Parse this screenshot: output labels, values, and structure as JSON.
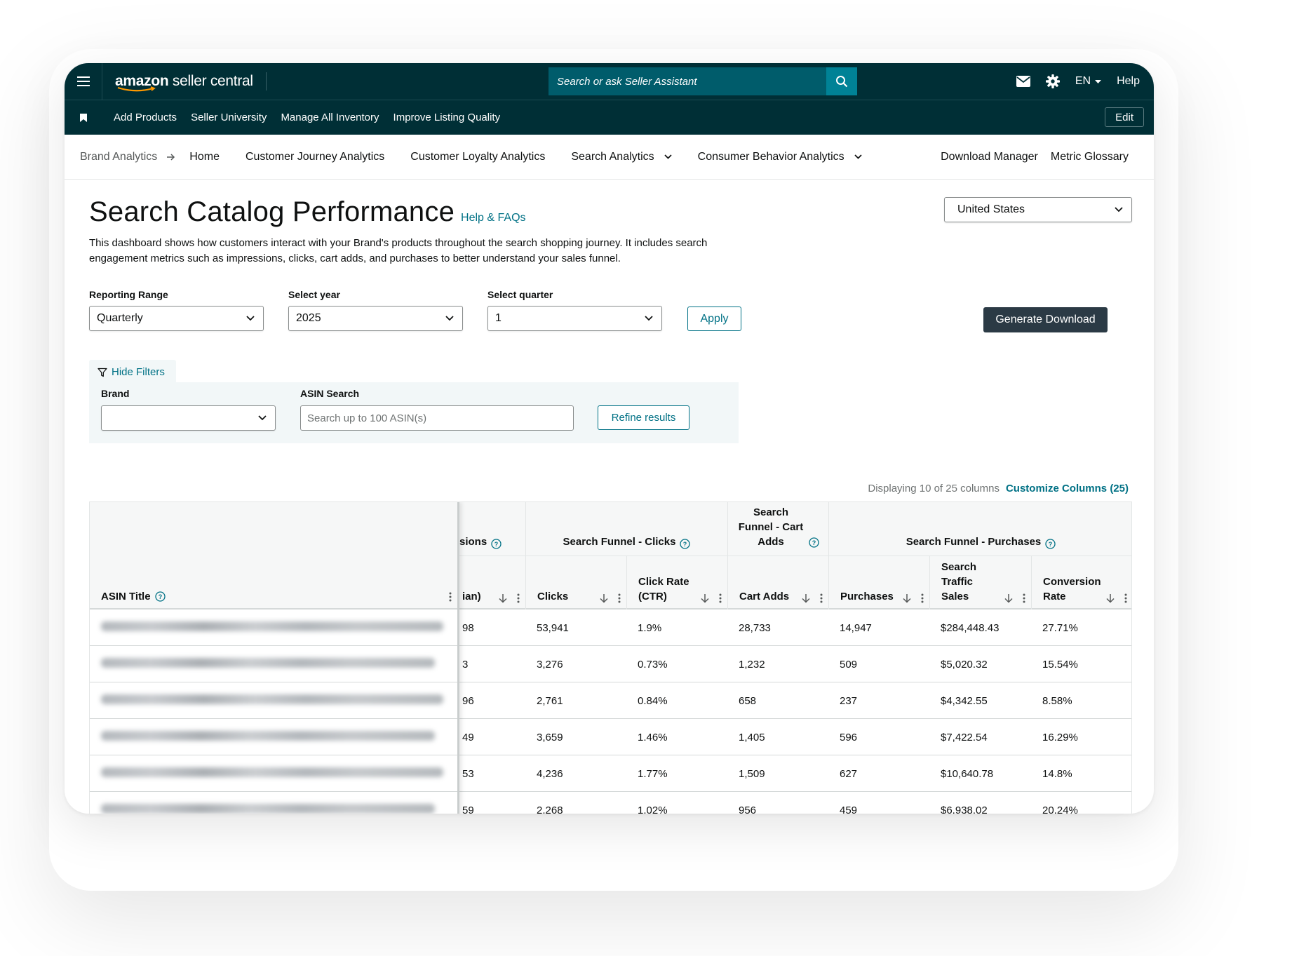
{
  "topbar": {
    "logo_bold": "amazon",
    "logo_rest": " seller central",
    "search_placeholder": "Search or ask Seller Assistant",
    "lang": "EN",
    "help": "Help"
  },
  "subbar": {
    "links": [
      "Add Products",
      "Seller University",
      "Manage All Inventory",
      "Improve Listing Quality"
    ],
    "edit": "Edit"
  },
  "nav": {
    "breadcrumb": "Brand Analytics",
    "items": [
      "Home",
      "Customer Journey Analytics",
      "Customer Loyalty Analytics",
      "Search Analytics",
      "Consumer Behavior Analytics"
    ],
    "download_manager": "Download Manager",
    "metric_glossary": "Metric Glossary"
  },
  "page": {
    "title": "Search Catalog Performance",
    "help_faqs": "Help & FAQs",
    "description": "This dashboard shows how customers interact with your Brand's products throughout the search shopping journey. It includes search engagement metrics such as impressions, clicks, cart adds, and purchases to better understand your sales funnel.",
    "country": "United States"
  },
  "controls": {
    "reporting_range_label": "Reporting Range",
    "reporting_range_value": "Quarterly",
    "year_label": "Select year",
    "year_value": "2025",
    "quarter_label": "Select quarter",
    "quarter_value": "1",
    "apply": "Apply",
    "generate_download": "Generate Download"
  },
  "filters": {
    "hide_filters": "Hide Filters",
    "brand_label": "Brand",
    "brand_value": "",
    "asin_label": "ASIN Search",
    "asin_placeholder": "Search up to 100 ASIN(s)",
    "refine": "Refine results"
  },
  "table_meta": {
    "displaying": "Displaying 10 of 25 columns",
    "customize": "Customize Columns (25)"
  },
  "table": {
    "groups": {
      "impressions_partial": "sions",
      "clicks": "Search Funnel - Clicks",
      "cart_adds": "Search Funnel - Cart Adds",
      "purchases": "Search Funnel - Purchases"
    },
    "columns": {
      "asin_title": "ASIN Title",
      "median_partial": "ian)",
      "clicks": "Clicks",
      "click_rate": "Click Rate (CTR)",
      "cart_adds": "Cart Adds",
      "purchases": "Purchases",
      "search_traffic_sales": "Search Traffic Sales",
      "conversion_rate": "Conversion Rate"
    },
    "rows": [
      {
        "partial": "98",
        "clicks": "53,941",
        "ctr": "1.9%",
        "cart_adds": "28,733",
        "purchases": "14,947",
        "sales": "$284,448.43",
        "conv": "27.71%"
      },
      {
        "partial": "3",
        "clicks": "3,276",
        "ctr": "0.73%",
        "cart_adds": "1,232",
        "purchases": "509",
        "sales": "$5,020.32",
        "conv": "15.54%"
      },
      {
        "partial": "96",
        "clicks": "2,761",
        "ctr": "0.84%",
        "cart_adds": "658",
        "purchases": "237",
        "sales": "$4,342.55",
        "conv": "8.58%"
      },
      {
        "partial": "49",
        "clicks": "3,659",
        "ctr": "1.46%",
        "cart_adds": "1,405",
        "purchases": "596",
        "sales": "$7,422.54",
        "conv": "16.29%"
      },
      {
        "partial": "53",
        "clicks": "4,236",
        "ctr": "1.77%",
        "cart_adds": "1,509",
        "purchases": "627",
        "sales": "$10,640.78",
        "conv": "14.8%"
      },
      {
        "partial": "59",
        "clicks": "2,268",
        "ctr": "1.02%",
        "cart_adds": "956",
        "purchases": "459",
        "sales": "$6,938.02",
        "conv": "20.24%"
      }
    ]
  },
  "colors": {
    "header_bg": "#002f36",
    "search_bg": "#005c6b",
    "search_btn": "#008296",
    "link": "#007185",
    "primary_btn": "#2b3a45",
    "filter_bg": "#f2f7f8"
  }
}
